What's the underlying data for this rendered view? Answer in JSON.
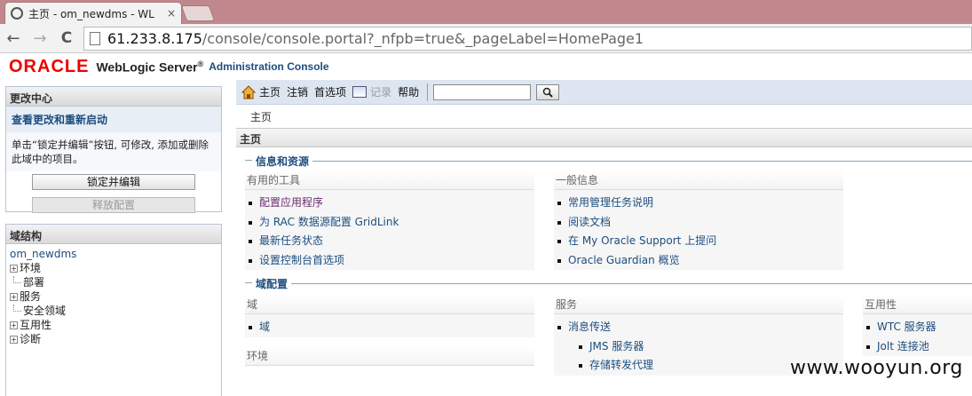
{
  "browser": {
    "tab_title": "主页 - om_newdms - WL",
    "tab_close": "×",
    "url_host": "61.233.8.175",
    "url_path": "/console/console.portal?_nfpb=true&_pageLabel=HomePage1",
    "back": "←",
    "forward": "→",
    "reload": "C"
  },
  "header": {
    "oracle": "ORACLE",
    "product": "WebLogic Server",
    "reg": "®",
    "console": "Administration Console"
  },
  "change_center": {
    "title": "更改中心",
    "link": "查看更改和重新启动",
    "desc": "单击“锁定并编辑”按钮, 可修改, 添加或删除此域中的项目。",
    "lock_button": "锁定并编辑",
    "release_button": "释放配置"
  },
  "domain_structure": {
    "title": "域结构",
    "root": "om_newdms",
    "nodes": [
      {
        "label": "环境",
        "expandable": true
      },
      {
        "label": "部署",
        "expandable": false
      },
      {
        "label": "服务",
        "expandable": true
      },
      {
        "label": "安全领域",
        "expandable": false
      },
      {
        "label": "互用性",
        "expandable": true
      },
      {
        "label": "诊断",
        "expandable": true
      }
    ],
    "expand_glyph": "+"
  },
  "toolbar": {
    "home": "主页",
    "logout": "注销",
    "prefs": "首选项",
    "record": "记录",
    "help": "帮助",
    "search_value": ""
  },
  "breadcrumb": "主页",
  "main": {
    "title": "主页",
    "info_section": "信息和资源",
    "useful_tools": {
      "title": "有用的工具",
      "items": [
        "配置应用程序",
        "为 RAC 数据源配置 GridLink",
        "最新任务状态",
        "设置控制台首选项"
      ]
    },
    "general_info": {
      "title": "一般信息",
      "items": [
        "常用管理任务说明",
        "阅读文档",
        "在 My Oracle Support 上提问",
        "Oracle Guardian 概览"
      ]
    },
    "domain_config_section": "域配置",
    "domain_col": {
      "title": "域",
      "items": [
        "域"
      ]
    },
    "environment_col": {
      "title": "环境"
    },
    "services_col": {
      "title": "服务",
      "items": [
        "消息传送"
      ],
      "sub_items": [
        "JMS 服务器",
        "存储转发代理"
      ]
    },
    "interop_col": {
      "title": "互用性",
      "items": [
        "WTC 服务器",
        "Jolt 连接池"
      ]
    }
  },
  "watermark": "www.wooyun.org",
  "colors": {
    "accent": "#1d4d7f",
    "oracle_red": "#e00000",
    "toolbar_bg": "#dde6f0"
  }
}
